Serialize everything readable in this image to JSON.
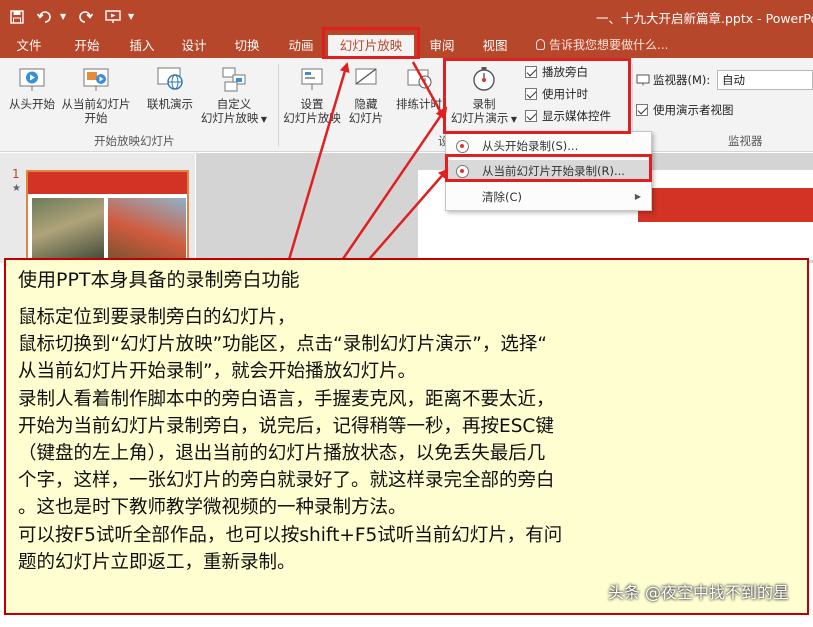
{
  "window": {
    "title": "一、十九大开启新篇章.pptx - PowerPoint"
  },
  "tabs": [
    {
      "label": "文件"
    },
    {
      "label": "开始"
    },
    {
      "label": "插入"
    },
    {
      "label": "设计"
    },
    {
      "label": "切换"
    },
    {
      "label": "动画"
    },
    {
      "label": "幻灯片放映",
      "active": true
    },
    {
      "label": "审阅"
    },
    {
      "label": "视图"
    }
  ],
  "tell_me": "告诉我您想要做什么...",
  "ribbon": {
    "start_group": {
      "from_beginning": [
        "从头开始"
      ],
      "from_current": [
        "从当前幻灯片",
        "开始"
      ],
      "online": [
        "联机演示"
      ],
      "custom": [
        "自定义",
        "幻灯片放映"
      ],
      "label": "开始放映幻灯片"
    },
    "setup_group": {
      "setup_show": [
        "设置",
        "幻灯片放映"
      ],
      "hide_slide": [
        "隐藏",
        "幻灯片"
      ],
      "rehearse": "排练计时",
      "record": [
        "录制",
        "幻灯片演示"
      ],
      "label_partial": "设"
    },
    "checkboxes": {
      "play_narrations": "播放旁白",
      "use_timings": "使用计时",
      "show_media_controls": "显示媒体控件"
    },
    "monitors_group": {
      "monitor_label": "监视器(M):",
      "monitor_value": "自动",
      "presenter_view": "使用演示者视图",
      "label": "监视器"
    }
  },
  "dropdown": {
    "items": [
      {
        "label": "从头开始录制(S)..."
      },
      {
        "label": "从当前幻灯片开始录制(R)..."
      },
      {
        "label": "清除(C)"
      }
    ]
  },
  "slides": {
    "number": "1",
    "star": "★"
  },
  "note": {
    "title": "使用PPT本身具备的录制旁白功能",
    "lines": [
      "鼠标定位到要录制旁白的幻灯片，",
      "鼠标切换到“幻灯片放映”功能区，点击“录制幻灯片演示”，选择“",
      "从当前幻灯片开始录制”，就会开始播放幻灯片。",
      "录制人看着制作脚本中的旁白语言，手握麦克风，距离不要太近，",
      "开始为当前幻灯片录制旁白，说完后，记得稍等一秒，再按ESC键",
      "（键盘的左上角），退出当前的幻灯片播放状态，以免丢失最后几",
      "个字，这样，一张幻灯片的旁白就录好了。就这样录完全部的旁白",
      "。这也是时下教师教学微视频的一种录制方法。",
      "可以按F5试听全部作品，也可以按shift+F5试听当前幻灯片，有问",
      "题的幻灯片立即返工，重新录制。"
    ]
  },
  "watermark": "头条 @夜空中找不到的星",
  "colors": {
    "accent": "#b7472a",
    "highlight": "#e02020",
    "note_bg": "#fefed0"
  }
}
